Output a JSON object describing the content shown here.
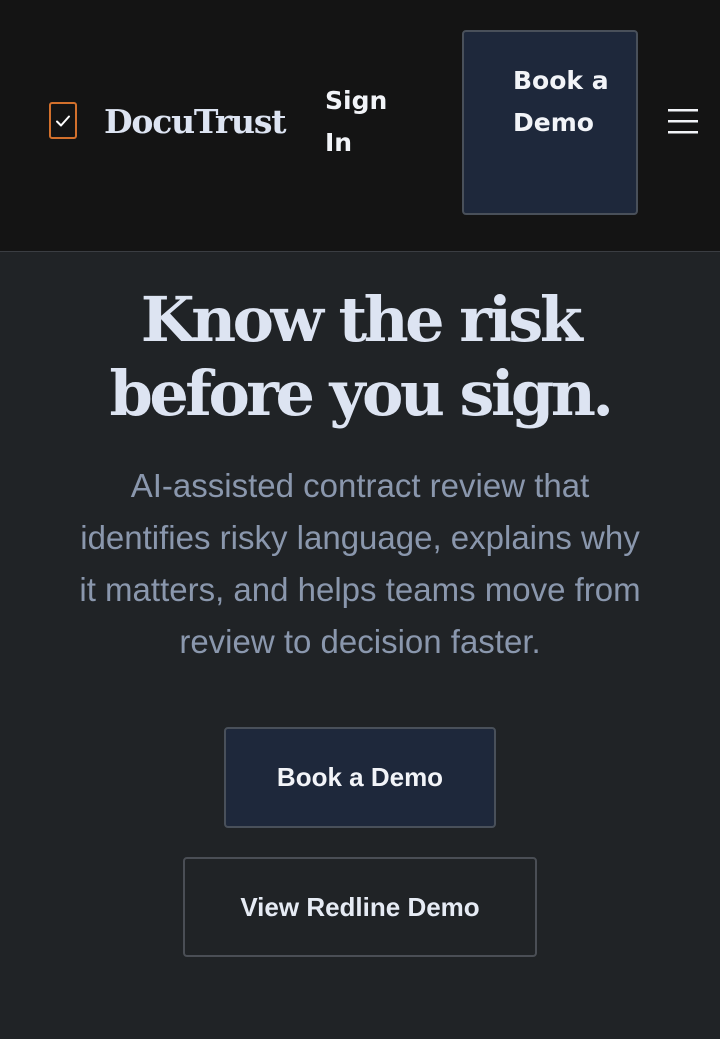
{
  "header": {
    "brand_name": "DocuTrust",
    "brand_icon": "checkbox-document-icon",
    "sign_in_label": "Sign In",
    "book_demo_label": "Book a Demo",
    "menu_icon": "hamburger-menu-icon"
  },
  "hero": {
    "headline_line1": "Know the risk",
    "headline_line2": "before you sign.",
    "subtext_line1": "AI-assisted contract review that",
    "subtext_line2": "identifies risky language, explains why",
    "subtext_line3": "it matters, and helps teams move from",
    "subtext_line4": "review to decision faster.",
    "primary_cta_label": "Book a Demo",
    "secondary_cta_label": "View Redline Demo"
  },
  "colors": {
    "header_background": "#141414",
    "page_background": "#202326",
    "brand_accent": "#d2702c",
    "button_fill": "#1e283b",
    "headline_text": "#dde4f2",
    "body_text": "#8a97ad"
  }
}
